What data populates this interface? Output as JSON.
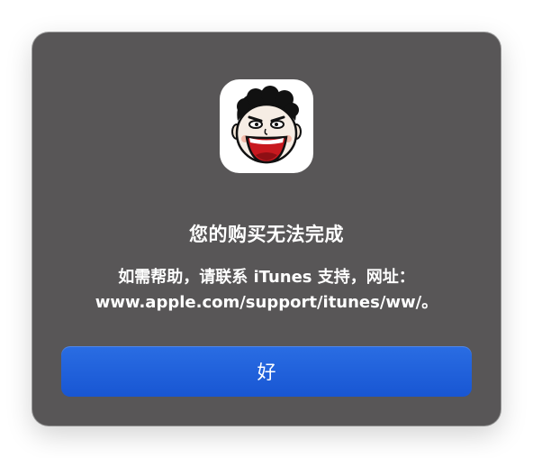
{
  "dialog": {
    "icon": "app-face-icon",
    "title": "您的购买无法完成",
    "message_lines": [
      "如需帮助，请联系 iTunes 支持，网址：",
      "www.apple.com/support/itunes/ww/。"
    ],
    "ok_label": "好",
    "colors": {
      "background": "#585657",
      "button": "#1f62dc",
      "text": "#ffffff"
    }
  }
}
